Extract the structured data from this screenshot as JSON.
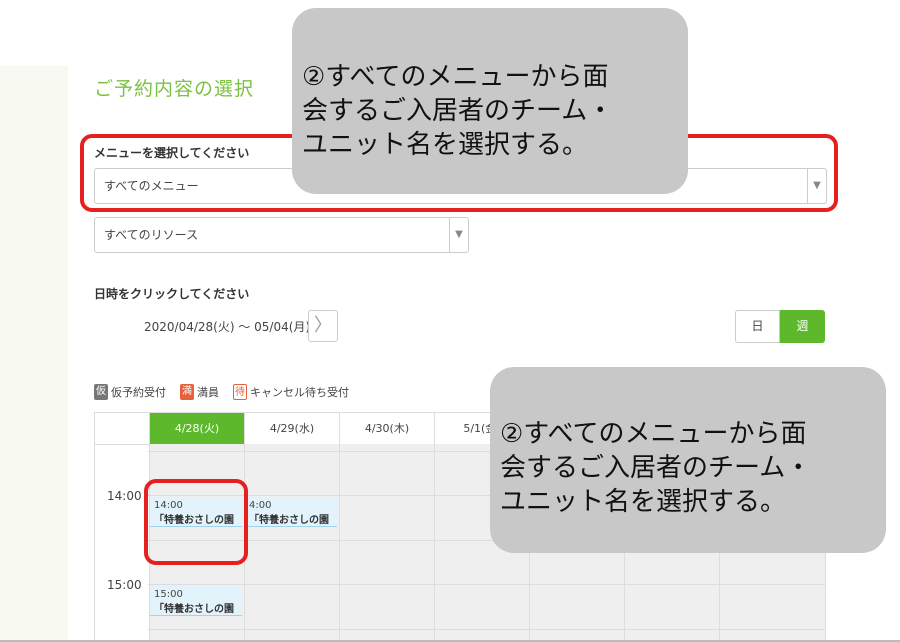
{
  "section_title": "ご予約内容の選択",
  "menu": {
    "label": "メニューを選択してください",
    "selected": "すべてのメニュー",
    "caret": "▼"
  },
  "resource": {
    "selected": "すべてのリソース",
    "caret": "▼"
  },
  "datetime": {
    "label": "日時をクリックしてください",
    "range": "2020/04/28(火) ～ 05/04(月)",
    "next_glyph": "〉"
  },
  "view_toggle": {
    "day": "日",
    "week": "週",
    "active": "week"
  },
  "legend": [
    {
      "tag": "仮",
      "label": "仮予約受付"
    },
    {
      "tag": "満",
      "label": "満員"
    },
    {
      "tag": "待",
      "label": "キャンセル待ち受付"
    }
  ],
  "calendar": {
    "days": [
      "4/28(火)",
      "4/29(水)",
      "4/30(木)",
      "5/1(金)"
    ],
    "active_day": "4/28(火)",
    "times": [
      "14:00",
      "15:00"
    ],
    "slots": [
      {
        "time": "14:00",
        "title": "「特養おさしの園"
      },
      {
        "time": "4:00",
        "title": "「特養おさしの園"
      },
      {
        "time": "15:00",
        "title": "「特養おさしの園"
      }
    ]
  },
  "callouts": [
    "②すべてのメニューから面\n会するご入居者のチーム・\nユニット名を選択する。",
    "②すべてのメニューから面\n会するご入居者のチーム・\nユニット名を選択する。"
  ],
  "colors": {
    "accent_green": "#5db82c",
    "title_green": "#7cc242",
    "highlight_red": "#e61f1f",
    "callout_gray": "#c8c8c8"
  }
}
